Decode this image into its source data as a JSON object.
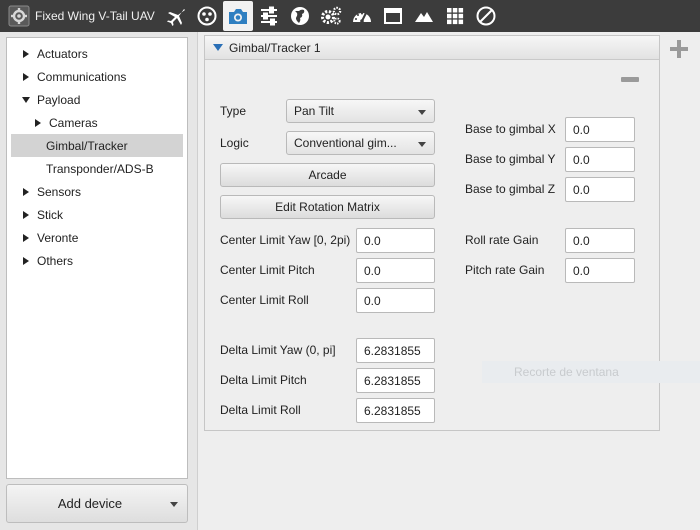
{
  "app": {
    "title": "Fixed Wing V-Tail UAV",
    "toolbar_icons": [
      "plane-icon",
      "dots-circle-icon",
      "camera-icon",
      "sliders-icon",
      "globe-icon",
      "gears-icon",
      "gauge-icon",
      "window-icon",
      "mountain-icon",
      "grid-icon",
      "forbidden-icon"
    ],
    "active_tool": "camera-icon"
  },
  "sidebar": {
    "items": [
      {
        "label": "Actuators",
        "expanded": false
      },
      {
        "label": "Communications",
        "expanded": false
      },
      {
        "label": "Payload",
        "expanded": true
      },
      {
        "label": "Cameras",
        "expanded": false
      },
      {
        "label": "Gimbal/Tracker",
        "selected": true
      },
      {
        "label": "Transponder/ADS-B"
      },
      {
        "label": "Sensors",
        "expanded": false
      },
      {
        "label": "Stick",
        "expanded": false
      },
      {
        "label": "Veronte",
        "expanded": false
      },
      {
        "label": "Others",
        "expanded": false
      }
    ],
    "add_device_label": "Add device"
  },
  "panel": {
    "title": "Gimbal/Tracker 1",
    "type_label": "Type",
    "type_value": "Pan Tilt",
    "logic_label": "Logic",
    "logic_value": "Conventional gim...",
    "arcade_label": "Arcade",
    "edit_matrix_label": "Edit Rotation Matrix",
    "center_yaw_label": "Center Limit Yaw [0, 2pi)",
    "center_yaw_value": "0.0",
    "center_pitch_label": "Center Limit Pitch",
    "center_pitch_value": "0.0",
    "center_roll_label": "Center Limit Roll",
    "center_roll_value": "0.0",
    "delta_yaw_label": "Delta Limit Yaw (0, pi]",
    "delta_yaw_value": "6.2831855",
    "delta_pitch_label": "Delta Limit Pitch",
    "delta_pitch_value": "6.2831855",
    "delta_roll_label": "Delta Limit Roll",
    "delta_roll_value": "6.2831855",
    "base_x_label": "Base to gimbal X",
    "base_x_value": "0.0",
    "base_y_label": "Base to gimbal Y",
    "base_y_value": "0.0",
    "base_z_label": "Base to gimbal Z",
    "base_z_value": "0.0",
    "roll_gain_label": "Roll rate Gain",
    "roll_gain_value": "0.0",
    "pitch_gain_label": "Pitch rate Gain",
    "pitch_gain_value": "0.0"
  },
  "ghost_text": "Recorte de ventana"
}
